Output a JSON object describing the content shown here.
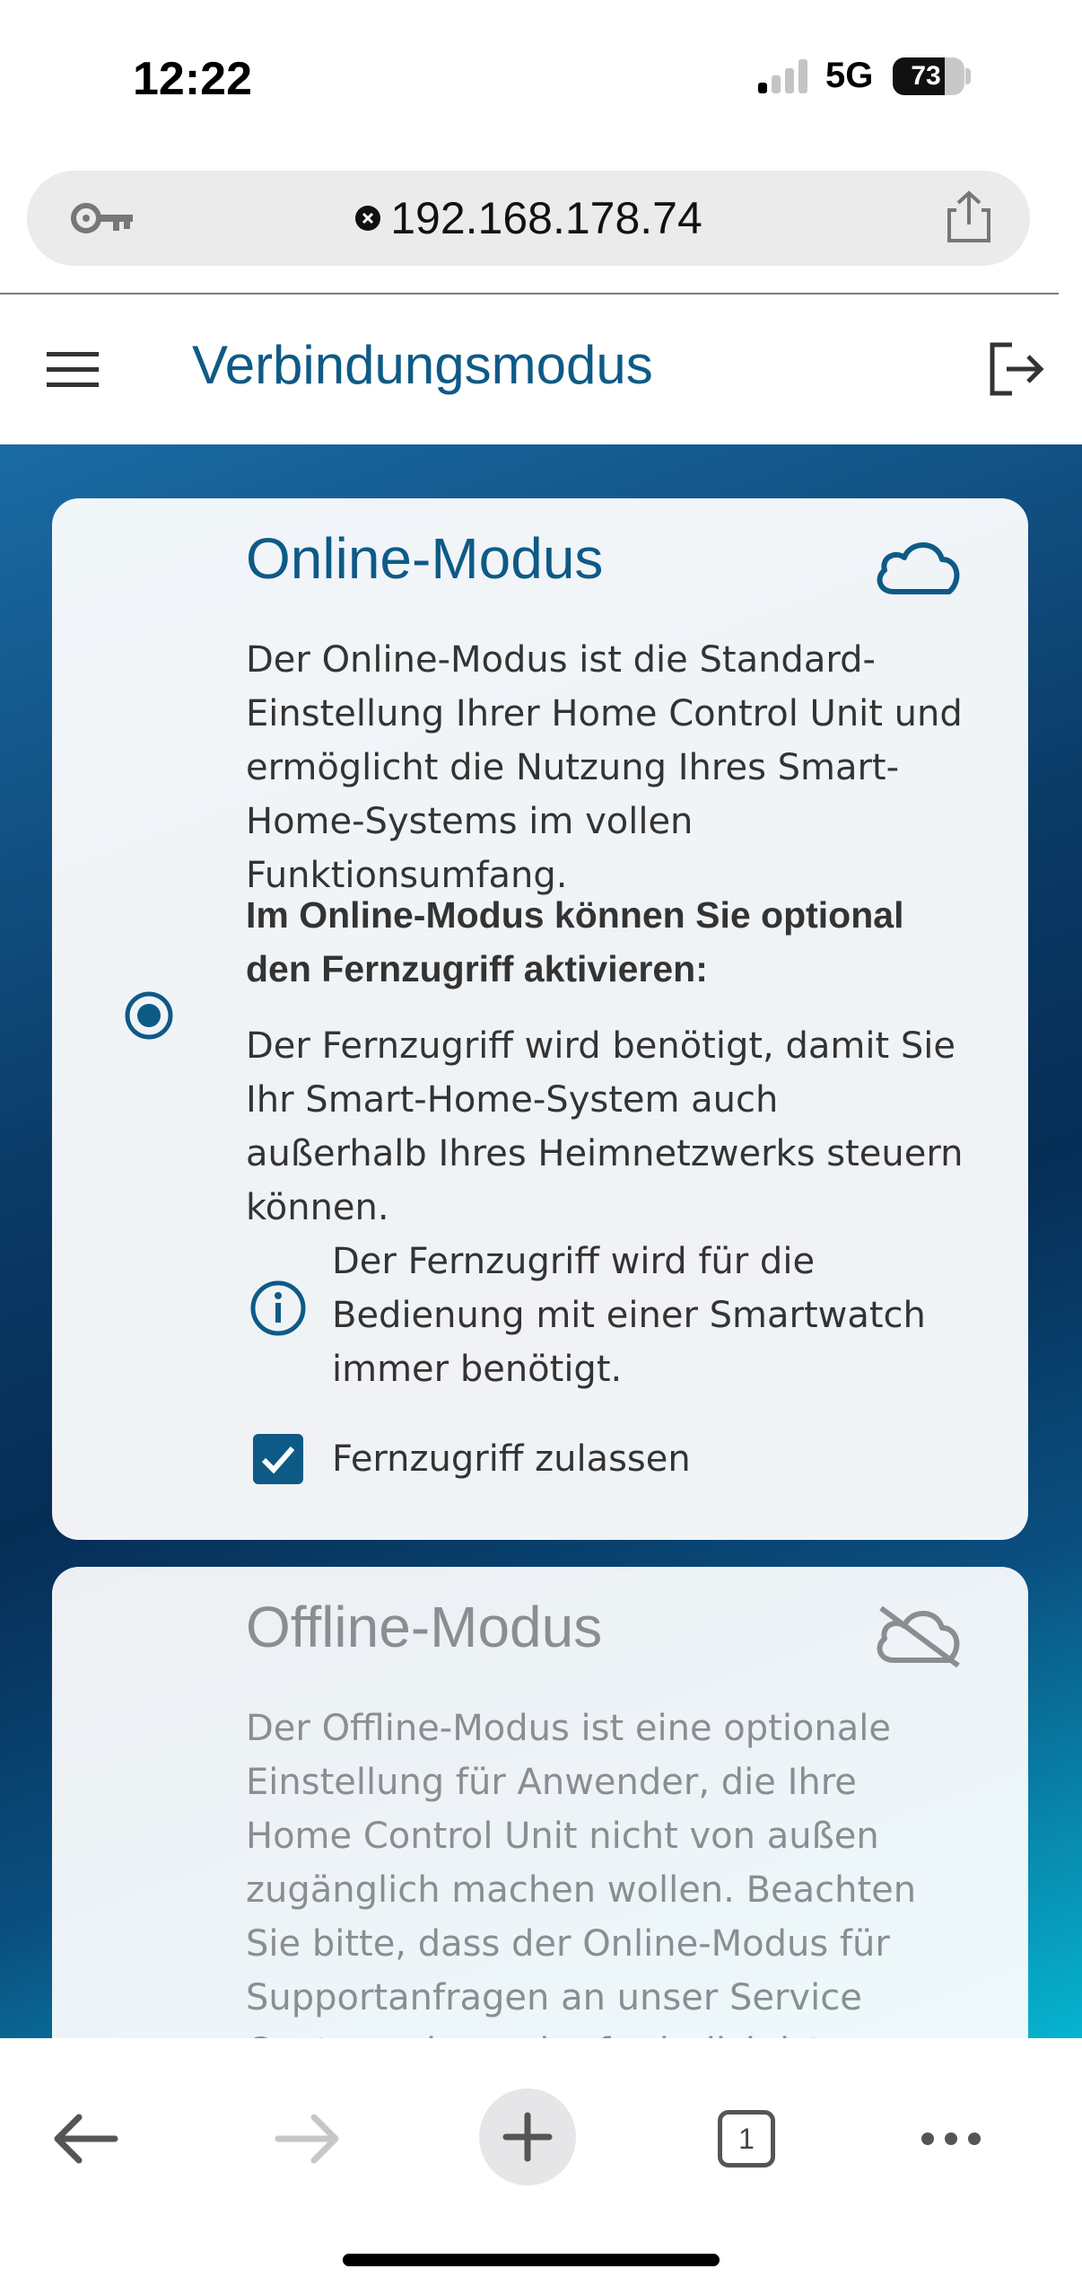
{
  "status_bar": {
    "time": "12:22",
    "network": "5G",
    "battery": "73"
  },
  "browser": {
    "url": "192.168.178.74",
    "tab_count": "1"
  },
  "header": {
    "title": "Verbindungsmodus"
  },
  "online_card": {
    "title": "Online-Modus",
    "selected": true,
    "description": "Der Online-Modus ist die Standard-Einstellung Ihrer Home Control Unit und ermöglicht die Nutzung Ihres Smart-Home-Systems im vollen Funktionsumfang.",
    "optional_heading": "Im Online-Modus können Sie optional den Fernzugriff aktivieren:",
    "remote_text": "Der Fernzugriff wird benötigt, damit Sie Ihr Smart-Home-System auch außerhalb Ihres Heimnetzwerks steuern können.",
    "info_text": "Der Fernzugriff wird für die Bedienung mit einer Smartwatch immer benötigt.",
    "checkbox_label": "Fernzugriff zulassen",
    "checkbox_checked": true
  },
  "offline_card": {
    "title": "Offline-Modus",
    "selected": false,
    "description": "Der Offline-Modus ist eine optionale Einstellung für Anwender, die Ihre Home Control Unit nicht von außen zugänglich machen wollen. Beachten Sie bitte, dass der Online-Modus für Supportanfragen an unser Service Center zwingend erforderlich ist."
  },
  "colors": {
    "accent": "#0e5a86",
    "disabled_text": "#8a8e92"
  },
  "icons": {
    "menu": "menu-icon",
    "logout": "logout-icon",
    "cloud": "cloud-icon",
    "cloud_off": "cloud-off-icon",
    "info": "info-icon",
    "back": "arrow-left-icon",
    "forward": "arrow-right-icon",
    "new_tab": "plus-icon",
    "more": "more-icon"
  }
}
